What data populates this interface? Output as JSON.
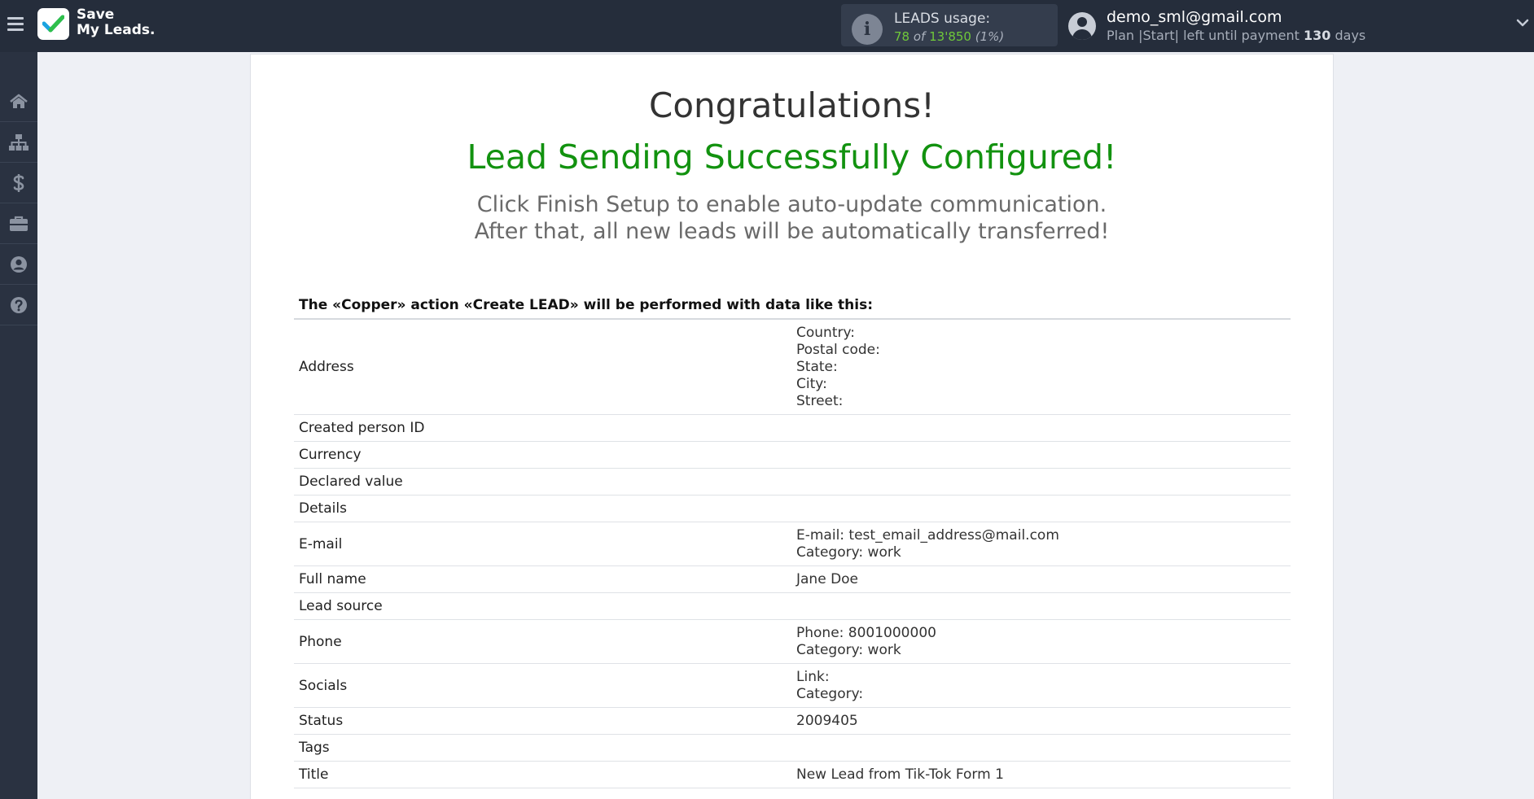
{
  "app": {
    "logo_line1": "Save",
    "logo_line2": "My Leads."
  },
  "usage": {
    "title": "LEADS usage:",
    "used": "78",
    "of": "of",
    "limit": "13'850",
    "percent": "(1%)"
  },
  "user": {
    "email": "demo_sml@gmail.com",
    "plan_text": "Plan |Start| left until payment",
    "days": "130",
    "days_unit": "days"
  },
  "sidebar": {
    "items": [
      "home-icon",
      "sitemap-icon",
      "dollar-icon",
      "briefcase-icon",
      "user-circle-icon",
      "help-icon"
    ]
  },
  "main": {
    "heading": "Congratulations!",
    "subheading": "Lead Sending Successfully Configured!",
    "instruction_line1": "Click Finish Setup to enable auto-update communication.",
    "instruction_line2": "After that, all new leads will be automatically transferred!",
    "action_title": "The «Copper» action «Create LEAD» will be performed with data like this:"
  },
  "rows": [
    {
      "label": "Address",
      "values": [
        "Country:",
        "Postal code:",
        "State:",
        "City:",
        "Street:"
      ]
    },
    {
      "label": "Created person ID",
      "values": [
        ""
      ]
    },
    {
      "label": "Currency",
      "values": [
        ""
      ]
    },
    {
      "label": "Declared value",
      "values": [
        ""
      ]
    },
    {
      "label": "Details",
      "values": [
        ""
      ]
    },
    {
      "label": "E-mail",
      "values": [
        "E-mail: test_email_address@mail.com",
        "Category: work"
      ]
    },
    {
      "label": "Full name",
      "values": [
        "Jane Doe"
      ]
    },
    {
      "label": "Lead source",
      "values": [
        ""
      ]
    },
    {
      "label": "Phone",
      "values": [
        "Phone: 8001000000",
        "Category: work"
      ]
    },
    {
      "label": "Socials",
      "values": [
        "Link:",
        "Category:"
      ]
    },
    {
      "label": "Status",
      "values": [
        "2009405"
      ]
    },
    {
      "label": "Tags",
      "values": [
        ""
      ]
    },
    {
      "label": "Title",
      "values": [
        "New Lead from Tik-Tok Form 1"
      ]
    }
  ],
  "colors": {
    "topbar": "#252d3b",
    "sidebar": "#2a3241",
    "success_green": "#12920f",
    "usage_green": "#6fc83a"
  }
}
